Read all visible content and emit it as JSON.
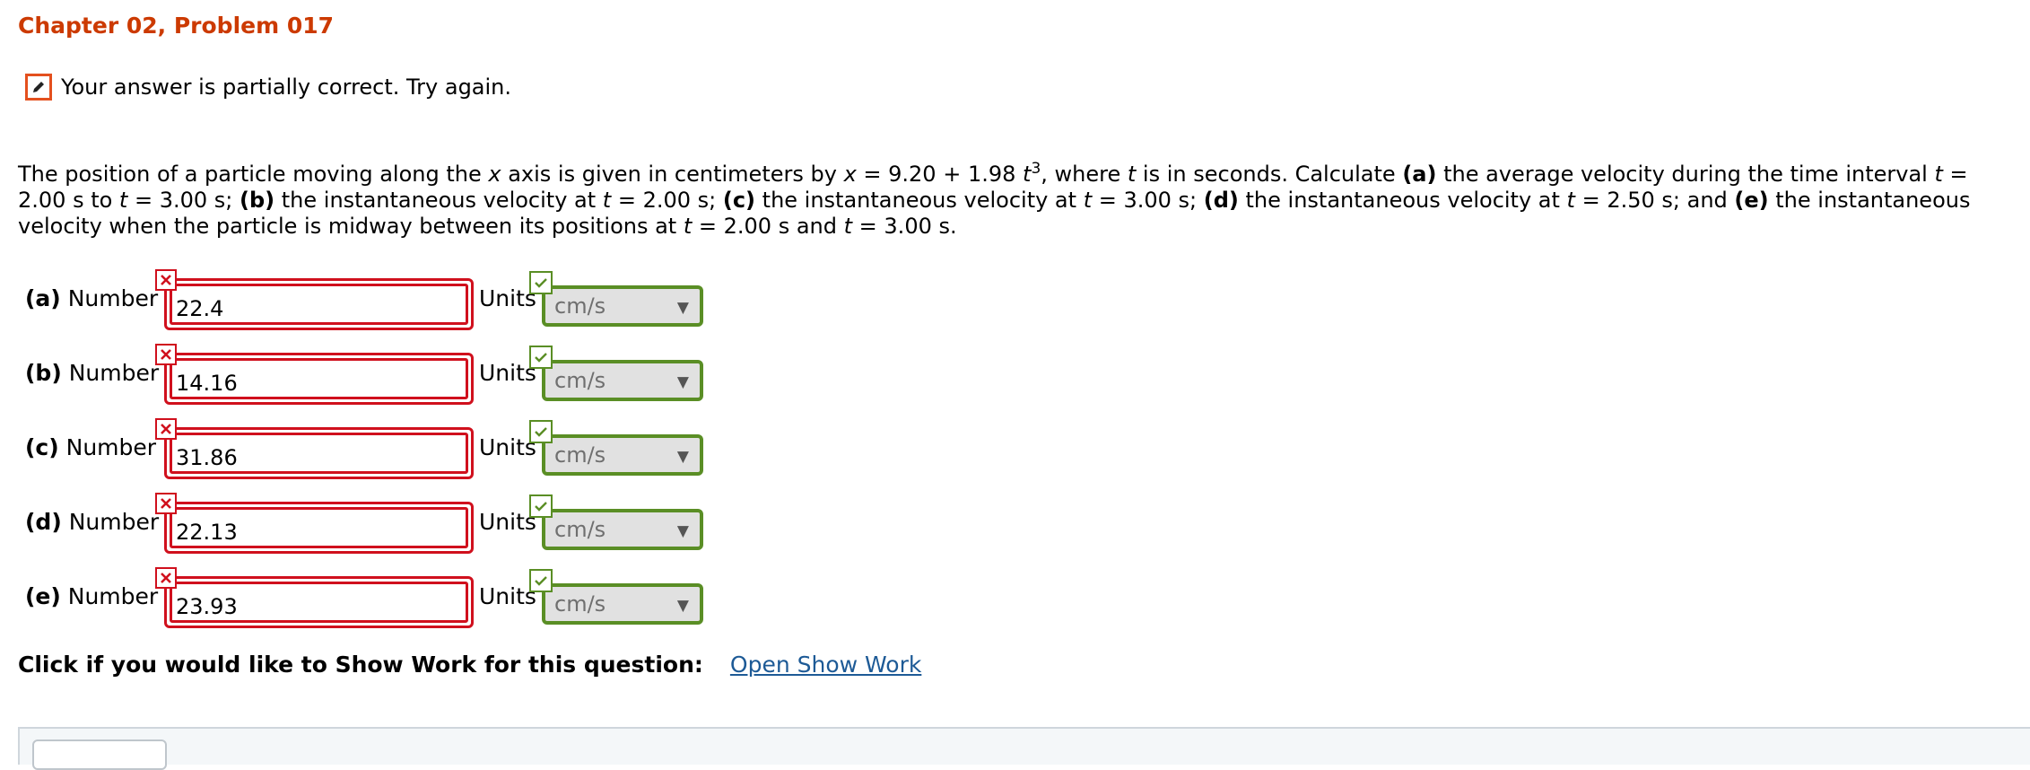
{
  "header": {
    "title": "Chapter 02, Problem 017"
  },
  "status": {
    "icon": "pencil-icon",
    "message": "Your answer is partially correct.  Try again."
  },
  "question": {
    "t1": "The position of a particle moving along the ",
    "var_x1": "x",
    "t2": " axis is given in centimeters by ",
    "var_x2": "x",
    "t3": " = 9.20 + 1.98 ",
    "var_t1": "t",
    "exp": "3",
    "t4": ", where ",
    "var_t2": "t",
    "t5": " is in seconds. Calculate ",
    "pa": "(a)",
    "t6": " the average velocity during the time interval ",
    "var_t3": "t",
    "t7": " = 2.00 s to ",
    "var_t4": "t",
    "t8": " = 3.00 s; ",
    "pb": "(b)",
    "t9": " the instantaneous velocity at ",
    "var_t5": "t",
    "t10": " = 2.00 s; ",
    "pc": "(c)",
    "t11": " the instantaneous velocity at ",
    "var_t6": "t",
    "t12": " = 3.00 s; ",
    "pd": "(d)",
    "t13": " the instantaneous velocity at ",
    "var_t7": "t",
    "t14": " = 2.50 s; and ",
    "pe": "(e)",
    "t15": " the instantaneous velocity when the particle is midway between its positions at ",
    "var_t8": "t",
    "t16": " = 2.00 s and ",
    "var_t9": "t",
    "t17": " = 3.00 s."
  },
  "answers": [
    {
      "part": "(a)",
      "label": "Number",
      "value": "22.4",
      "units_label": "Units",
      "unit": "cm/s",
      "number_status": "incorrect",
      "unit_status": "correct"
    },
    {
      "part": "(b)",
      "label": "Number",
      "value": "14.16",
      "units_label": "Units",
      "unit": "cm/s",
      "number_status": "incorrect",
      "unit_status": "correct"
    },
    {
      "part": "(c)",
      "label": "Number",
      "value": "31.86",
      "units_label": "Units",
      "unit": "cm/s",
      "number_status": "incorrect",
      "unit_status": "correct"
    },
    {
      "part": "(d)",
      "label": "Number",
      "value": "22.13",
      "units_label": "Units",
      "unit": "cm/s",
      "number_status": "incorrect",
      "unit_status": "correct"
    },
    {
      "part": "(e)",
      "label": "Number",
      "value": "23.93",
      "units_label": "Units",
      "unit": "cm/s",
      "number_status": "incorrect",
      "unit_status": "correct"
    }
  ],
  "show_work": {
    "label": "Click if you would like to Show Work for this question:",
    "link": "Open Show Work"
  },
  "colors": {
    "title": "#cc3a00",
    "incorrect": "#d0101d",
    "correct": "#5a8e25",
    "link": "#1d5a96"
  }
}
